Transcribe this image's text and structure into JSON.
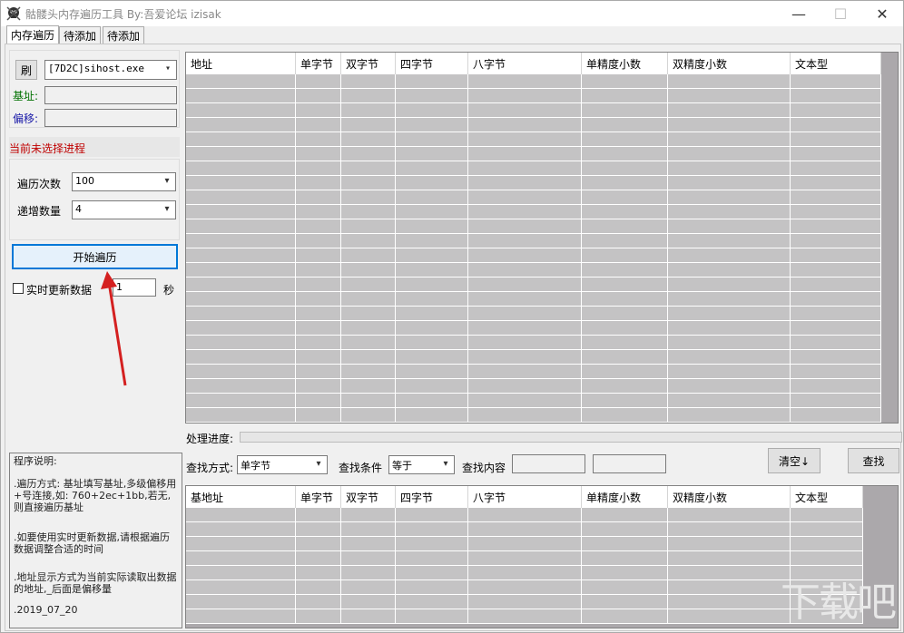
{
  "window": {
    "title": "骷髅头内存遍历工具 By:吾爱论坛 izisak",
    "minimize_glyph": "—",
    "maximize_glyph": "☐",
    "close_glyph": "✕"
  },
  "tabs": [
    "内存遍历",
    "待添加",
    "待添加"
  ],
  "left": {
    "refresh_label": "刷",
    "process_value": "[7D2C]sihost.exe",
    "base_label": "基址:",
    "offset_label": "偏移:",
    "status_text": "当前未选择进程",
    "iterations_label": "遍历次数",
    "iterations_value": "100",
    "increment_label": "递增数量",
    "increment_value": "4",
    "start_button": "开始遍历",
    "realtime_label": "实时更新数据",
    "realtime_checked": false,
    "interval_value": "1",
    "seconds_label": "秒"
  },
  "description": {
    "title": "程序说明:",
    "lines": [
      ".遍历方式: 基址填写基址,多级偏移用+号连接,如: 760+2ec+1bb,若无,则直接遍历基址",
      ".如要使用实时更新数据,请根据遍历数据调整合适的时间",
      ".地址显示方式为当前实际读取出数据的地址,_后面是偏移量",
      ".2019_07_20"
    ]
  },
  "main_grid": {
    "headers": [
      "地址",
      "单字节",
      "双字节",
      "四字节",
      "八字节",
      "单精度小数",
      "双精度小数",
      "文本型"
    ]
  },
  "progress": {
    "label": "处理进度:",
    "value": 0
  },
  "search": {
    "mode_label": "查找方式:",
    "mode_value": "单字节",
    "condition_label": "查找条件",
    "condition_value": "等于",
    "content_label": "查找内容",
    "content_value": "",
    "content_value2": "",
    "clear_button": "清空↓",
    "find_button": "查找"
  },
  "result_grid": {
    "headers": [
      "基地址",
      "单字节",
      "双字节",
      "四字节",
      "八字节",
      "单精度小数",
      "双精度小数",
      "文本型"
    ]
  },
  "colors": {
    "accent_red": "#cc1e1e",
    "status_red": "#c00000",
    "base_green": "#007000",
    "offset_blue": "#1a1aa8"
  },
  "icons": {
    "app": "skull-icon",
    "annotation": "red-arrow"
  }
}
